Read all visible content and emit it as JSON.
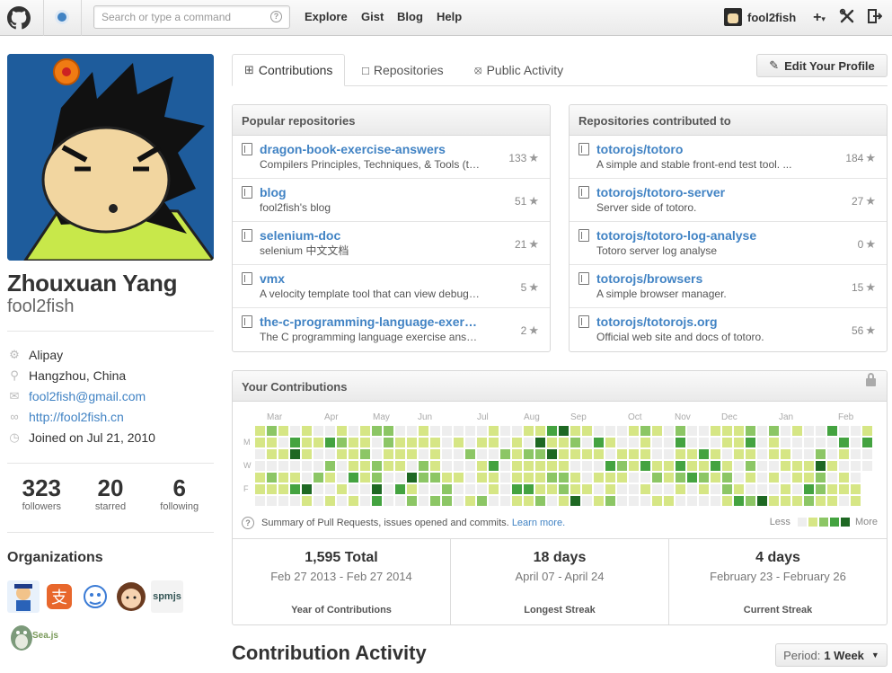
{
  "header": {
    "search_placeholder": "Search or type a command",
    "search_hint": "?",
    "nav": [
      "Explore",
      "Gist",
      "Blog",
      "Help"
    ],
    "username": "fool2fish",
    "plus_label": "+",
    "caret": "▾"
  },
  "profile": {
    "fullname": "Zhouxuan Yang",
    "login": "fool2fish",
    "details": {
      "company": "Alipay",
      "location": "Hangzhou, China",
      "email": "fool2fish@gmail.com",
      "url": "http://fool2fish.cn",
      "joined": "Joined on Jul 21, 2010"
    },
    "stats": [
      {
        "num": "323",
        "label": "followers"
      },
      {
        "num": "20",
        "label": "starred"
      },
      {
        "num": "6",
        "label": "following"
      }
    ],
    "orgs_title": "Organizations",
    "org_labels": {
      "spmjs": "spmjs",
      "seajs": "Sea.js"
    }
  },
  "tabs": {
    "contributions": "Contributions",
    "repositories": "Repositories",
    "public_activity": "Public Activity"
  },
  "edit_profile": "Edit Your Profile",
  "popular": {
    "title": "Popular repositories",
    "repos": [
      {
        "name": "dragon-book-exercise-answers",
        "desc": "Compilers Principles, Techniques, & Tools (the Dragon Book)",
        "stars": "133"
      },
      {
        "name": "blog",
        "desc": "fool2fish's blog",
        "stars": "51"
      },
      {
        "name": "selenium-doc",
        "desc": "selenium 中文文档",
        "stars": "21"
      },
      {
        "name": "vmx",
        "desc": "A velocity template tool that can view debug templates",
        "stars": "5"
      },
      {
        "name": "the-c-programming-language-exercise-answers",
        "desc": "The C programming language exercise answers",
        "stars": "2"
      }
    ]
  },
  "contributed": {
    "title": "Repositories contributed to",
    "repos": [
      {
        "name": "totorojs/totoro",
        "desc": "A simple and stable front-end test tool. ...",
        "stars": "184"
      },
      {
        "name": "totorojs/totoro-server",
        "desc": "Server side of totoro.",
        "stars": "27"
      },
      {
        "name": "totorojs/totoro-log-analyse",
        "desc": "Totoro server log analyse",
        "stars": "0"
      },
      {
        "name": "totorojs/browsers",
        "desc": "A simple browser manager.",
        "stars": "15"
      },
      {
        "name": "totorojs/totorojs.org",
        "desc": "Official web site and docs of totoro.",
        "stars": "56"
      }
    ]
  },
  "contrib": {
    "title": "Your Contributions",
    "months": [
      "Mar",
      "Apr",
      "May",
      "Jun",
      "Jul",
      "Aug",
      "Sep",
      "Oct",
      "Nov",
      "Dec",
      "Jan",
      "Feb"
    ],
    "days": [
      "M",
      "W",
      "F"
    ],
    "summary": "Summary of Pull Requests, issues opened and commits.",
    "learn_more": "Learn more.",
    "legend_less": "Less",
    "legend_more": "More",
    "colors": [
      "#eeeeee",
      "#d6e685",
      "#8cc665",
      "#44a340",
      "#1e6823"
    ],
    "stats": [
      {
        "big": "1,595 Total",
        "range": "Feb 27 2013 - Feb 27 2014",
        "caption": "Year of Contributions"
      },
      {
        "big": "18 days",
        "range": "April 07 - April 24",
        "caption": "Longest Streak"
      },
      {
        "big": "4 days",
        "range": "February 23 - February 26",
        "caption": "Current Streak"
      }
    ]
  },
  "activity": {
    "title": "Contribution Activity",
    "period_label": "Period:",
    "period_value": "1 Week"
  }
}
